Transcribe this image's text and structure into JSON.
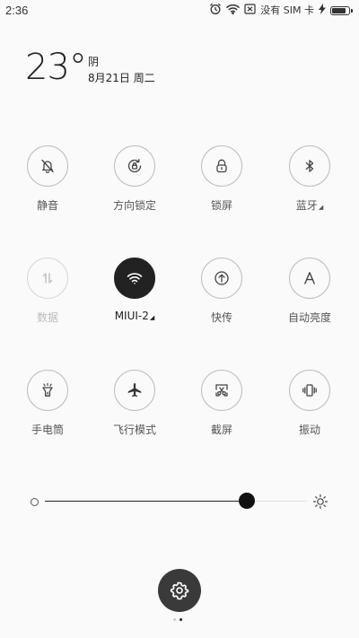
{
  "status_bar": {
    "time": "2:36",
    "no_sim_text": "没有 SIM 卡",
    "icons": [
      "alarm-icon",
      "wifi-icon",
      "sim-off-icon",
      "charging-icon",
      "battery-icon"
    ],
    "battery_level": 0.9
  },
  "weather": {
    "temperature": "23°",
    "condition": "阴",
    "date": "8月21日 周二"
  },
  "toggles": [
    {
      "label": "静音",
      "icon": "silent-bell-icon",
      "state": "off"
    },
    {
      "label": "方向锁定",
      "icon": "rotation-lock-icon",
      "state": "off"
    },
    {
      "label": "锁屏",
      "icon": "lock-icon",
      "state": "off"
    },
    {
      "label": "蓝牙",
      "icon": "bluetooth-icon",
      "state": "off",
      "has_more": true
    },
    {
      "label": "数据",
      "icon": "mobile-data-icon",
      "state": "disabled"
    },
    {
      "label": "MIUI-2",
      "icon": "wifi-icon",
      "state": "on",
      "has_more": true
    },
    {
      "label": "快传",
      "icon": "quick-share-icon",
      "state": "off"
    },
    {
      "label": "自动亮度",
      "icon": "auto-brightness-icon",
      "state": "off"
    },
    {
      "label": "手电筒",
      "icon": "flashlight-icon",
      "state": "off"
    },
    {
      "label": "飞行模式",
      "icon": "airplane-icon",
      "state": "off"
    },
    {
      "label": "截屏",
      "icon": "screenshot-icon",
      "state": "off"
    },
    {
      "label": "振动",
      "icon": "vibrate-icon",
      "state": "off"
    }
  ],
  "brightness": {
    "level": 0.77
  },
  "settings": {
    "icon": "gear-icon"
  },
  "pager": {
    "count": 2,
    "active": 1
  }
}
